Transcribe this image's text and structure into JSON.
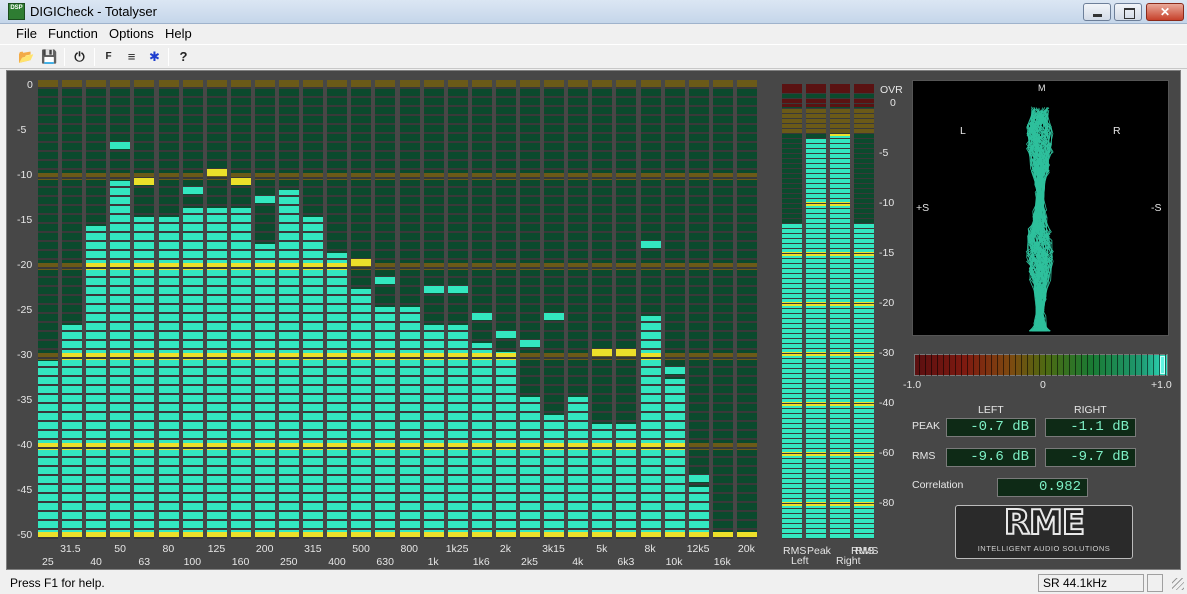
{
  "window": {
    "title": "DIGICheck - Totalyser",
    "app_icon": "DSP"
  },
  "menu": [
    "File",
    "Function",
    "Options",
    "Help"
  ],
  "toolbar_icons": [
    "open-icon",
    "save-icon",
    "power-icon",
    "function-icon",
    "options-icon",
    "settings-icon",
    "help-icon"
  ],
  "toolbar_glyphs": [
    "📂",
    "💾",
    "⏻",
    "F",
    "≡",
    "✱",
    "?"
  ],
  "spectrum": {
    "y_ticks": [
      "0",
      "-5",
      "-10",
      "-15",
      "-20",
      "-25",
      "-30",
      "-35",
      "-40",
      "-45",
      "-50"
    ],
    "x_labels_top": [
      "31.5",
      "50",
      "80",
      "125",
      "200",
      "315",
      "500",
      "800",
      "1k25",
      "2k",
      "3k15",
      "5k",
      "8k",
      "12k5",
      "20k"
    ],
    "x_labels_bottom": [
      "25",
      "40",
      "63",
      "100",
      "160",
      "250",
      "400",
      "630",
      "1k",
      "1k6",
      "2k5",
      "4k",
      "6k3",
      "10k",
      "16k"
    ],
    "bands": [
      "25",
      "31.5",
      "40",
      "50",
      "63",
      "80",
      "100",
      "125",
      "160",
      "200",
      "250",
      "315",
      "400",
      "500",
      "630",
      "800",
      "1k",
      "1k25",
      "1k6",
      "2k",
      "2k5",
      "3k15",
      "4k",
      "5k",
      "6k3",
      "8k",
      "10k",
      "12k5",
      "16k",
      "20k"
    ],
    "levels_db": [
      -30.5,
      -26.5,
      -15.5,
      -10.5,
      -14.5,
      -14.5,
      -13.5,
      -13.5,
      -13.5,
      -17.5,
      -11.5,
      -14.5,
      -18.5,
      -22.5,
      -24.5,
      -24.5,
      -26.5,
      -26.5,
      -28.5,
      -29.5,
      -34.5,
      -36.5,
      -34.5,
      -37.5,
      -37.5,
      -25.5,
      -32.5,
      -44.5,
      -50,
      -50
    ],
    "peak_hold_db": [
      null,
      null,
      null,
      -6.5,
      -10.5,
      null,
      -11.5,
      -9.5,
      -10.5,
      -12.5,
      null,
      null,
      null,
      -19.5,
      -21.5,
      null,
      -22.5,
      -22.5,
      -25.5,
      -27.5,
      -28.5,
      -25.5,
      null,
      -29.5,
      -29.5,
      -17.5,
      -31.5,
      -43.5,
      null,
      null
    ]
  },
  "level_meter": {
    "ovr_label": "OVR",
    "scale": [
      "0",
      "-5",
      "-10",
      "-15",
      "-20",
      "-30",
      "-40",
      "-60",
      "-80"
    ],
    "channels": [
      {
        "top": "RMS",
        "bottom": "",
        "level": 0.73
      },
      {
        "top": "Peak",
        "bottom": "Left",
        "level": 0.93
      },
      {
        "top": "Peak",
        "bottom": "",
        "level": 0.94
      },
      {
        "top": "RMS",
        "bottom": "Right",
        "level": 0.73
      }
    ],
    "bottom_labels": [
      "Left",
      "Right"
    ]
  },
  "goniometer": {
    "left": "L",
    "right": "R",
    "plus_s": "+S",
    "minus_s": "-S",
    "center_marker": "M"
  },
  "correlation": {
    "min": "-1.0",
    "mid": "0",
    "max": "+1.0",
    "value": 0.982
  },
  "readouts": {
    "left_header": "LEFT",
    "right_header": "RIGHT",
    "peak_label": "PEAK",
    "rms_label": "RMS",
    "peak_left": "-0.7 dB",
    "peak_right": "-1.1 dB",
    "rms_left": "-9.6 dB",
    "rms_right": "-9.7 dB",
    "correlation_label": "Correlation",
    "correlation_value": "0.982"
  },
  "logo": {
    "name": "RME",
    "tagline": "INTELLIGENT AUDIO SOLUTIONS"
  },
  "status": {
    "help": "Press F1 for help.",
    "sample_rate": "SR 44.1kHz"
  },
  "colors": {
    "active": "#33e8c0",
    "active_yellow": "#ece02a",
    "inactive": "#0b4a2d",
    "inactive_yellow": "#6b5a18",
    "inactive_red": "#5a1212",
    "background": "#474747"
  }
}
